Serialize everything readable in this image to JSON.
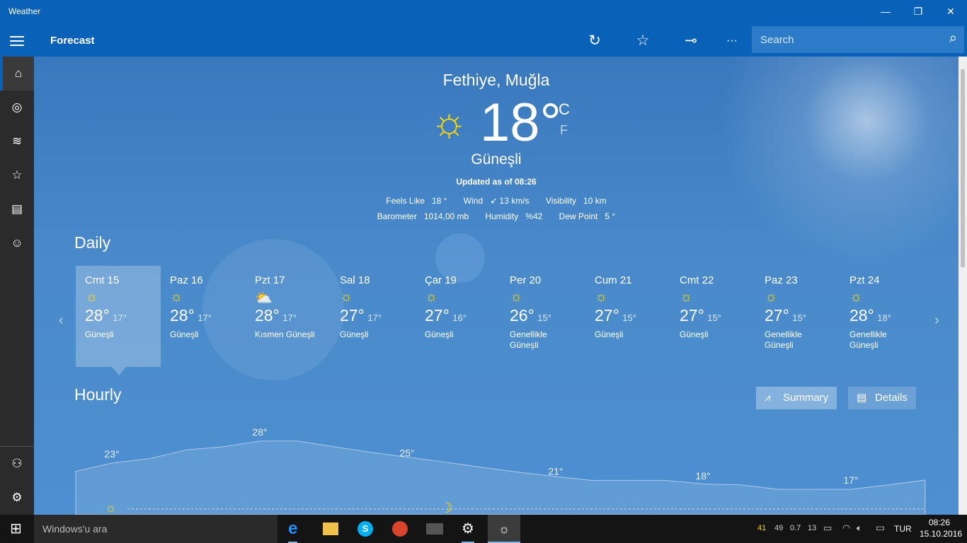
{
  "window": {
    "title": "Weather",
    "minimize": "—",
    "maximize": "❐",
    "close": "✕"
  },
  "header": {
    "title": "Forecast",
    "refresh": "↻",
    "favorite": "☆",
    "pin": "⊸",
    "more": "···",
    "search_placeholder": "Search",
    "search_icon": "⌕"
  },
  "sidebar": {
    "items": [
      {
        "name": "home",
        "icon": "⌂"
      },
      {
        "name": "maps",
        "icon": "◎"
      },
      {
        "name": "historical",
        "icon": "≋"
      },
      {
        "name": "places",
        "icon": "☆"
      },
      {
        "name": "news",
        "icon": "▤"
      },
      {
        "name": "life",
        "icon": "☺"
      }
    ],
    "bottom": [
      {
        "name": "account",
        "icon": "⚇"
      },
      {
        "name": "settings",
        "icon": "⚙"
      }
    ]
  },
  "current": {
    "location": "Fethiye, Muğla",
    "temp": "18°",
    "unit_c": "C",
    "unit_f": "F",
    "condition": "Güneşli",
    "updated": "Updated as of 08:26",
    "details_row1": [
      {
        "label": "Feels Like",
        "value": "18 °"
      },
      {
        "label": "Wind",
        "value": "➶ 13 km/s"
      },
      {
        "label": "Visibility",
        "value": "10 km"
      }
    ],
    "details_row2": [
      {
        "label": "Barometer",
        "value": "1014,00 mb"
      },
      {
        "label": "Humidity",
        "value": "%42"
      },
      {
        "label": "Dew Point",
        "value": "5 °"
      }
    ]
  },
  "daily": {
    "title": "Daily",
    "prev": "‹",
    "next": "›",
    "days": [
      {
        "name": "Cmt 15",
        "icon": "☼",
        "hi": "28°",
        "lo": "17°",
        "cond": "Güneşli"
      },
      {
        "name": "Paz 16",
        "icon": "☼",
        "hi": "28°",
        "lo": "17°",
        "cond": "Güneşli"
      },
      {
        "name": "Pzt 17",
        "icon": "⛅",
        "hi": "28°",
        "lo": "17°",
        "cond": "Kısmen Güneşli"
      },
      {
        "name": "Sal 18",
        "icon": "☼",
        "hi": "27°",
        "lo": "17°",
        "cond": "Güneşli"
      },
      {
        "name": "Çar 19",
        "icon": "☼",
        "hi": "27°",
        "lo": "16°",
        "cond": "Güneşli"
      },
      {
        "name": "Per 20",
        "icon": "☼",
        "hi": "26°",
        "lo": "15°",
        "cond": "Genellikle Güneşli"
      },
      {
        "name": "Cum 21",
        "icon": "☼",
        "hi": "27°",
        "lo": "15°",
        "cond": "Güneşli"
      },
      {
        "name": "Cmt 22",
        "icon": "☼",
        "hi": "27°",
        "lo": "15°",
        "cond": "Güneşli"
      },
      {
        "name": "Paz 23",
        "icon": "☼",
        "hi": "27°",
        "lo": "15°",
        "cond": "Genellikle Güneşli"
      },
      {
        "name": "Pzt 24",
        "icon": "☼",
        "hi": "28°",
        "lo": "18°",
        "cond": "Genellikle Güneşli"
      }
    ]
  },
  "hourly": {
    "title": "Hourly",
    "summary": "Summary",
    "details": "Details",
    "labels": [
      "23°",
      "28°",
      "25°",
      "21°",
      "18°",
      "17°"
    ],
    "curve": [
      21.1,
      23,
      24,
      26,
      26.7,
      28,
      28,
      26.7,
      25.4,
      24.3,
      23.2,
      22,
      20.9,
      19.9,
      19,
      19,
      19,
      18.2,
      18,
      17,
      17,
      17,
      18,
      19.1
    ],
    "icons": [
      "☼",
      "☽"
    ]
  },
  "taskbar": {
    "start": "⊞",
    "search": "Windows'u ara",
    "tray": [
      "41",
      "49",
      "0.7",
      "13"
    ],
    "lang": "TUR",
    "time": "08:26",
    "date": "15.10.2016"
  }
}
